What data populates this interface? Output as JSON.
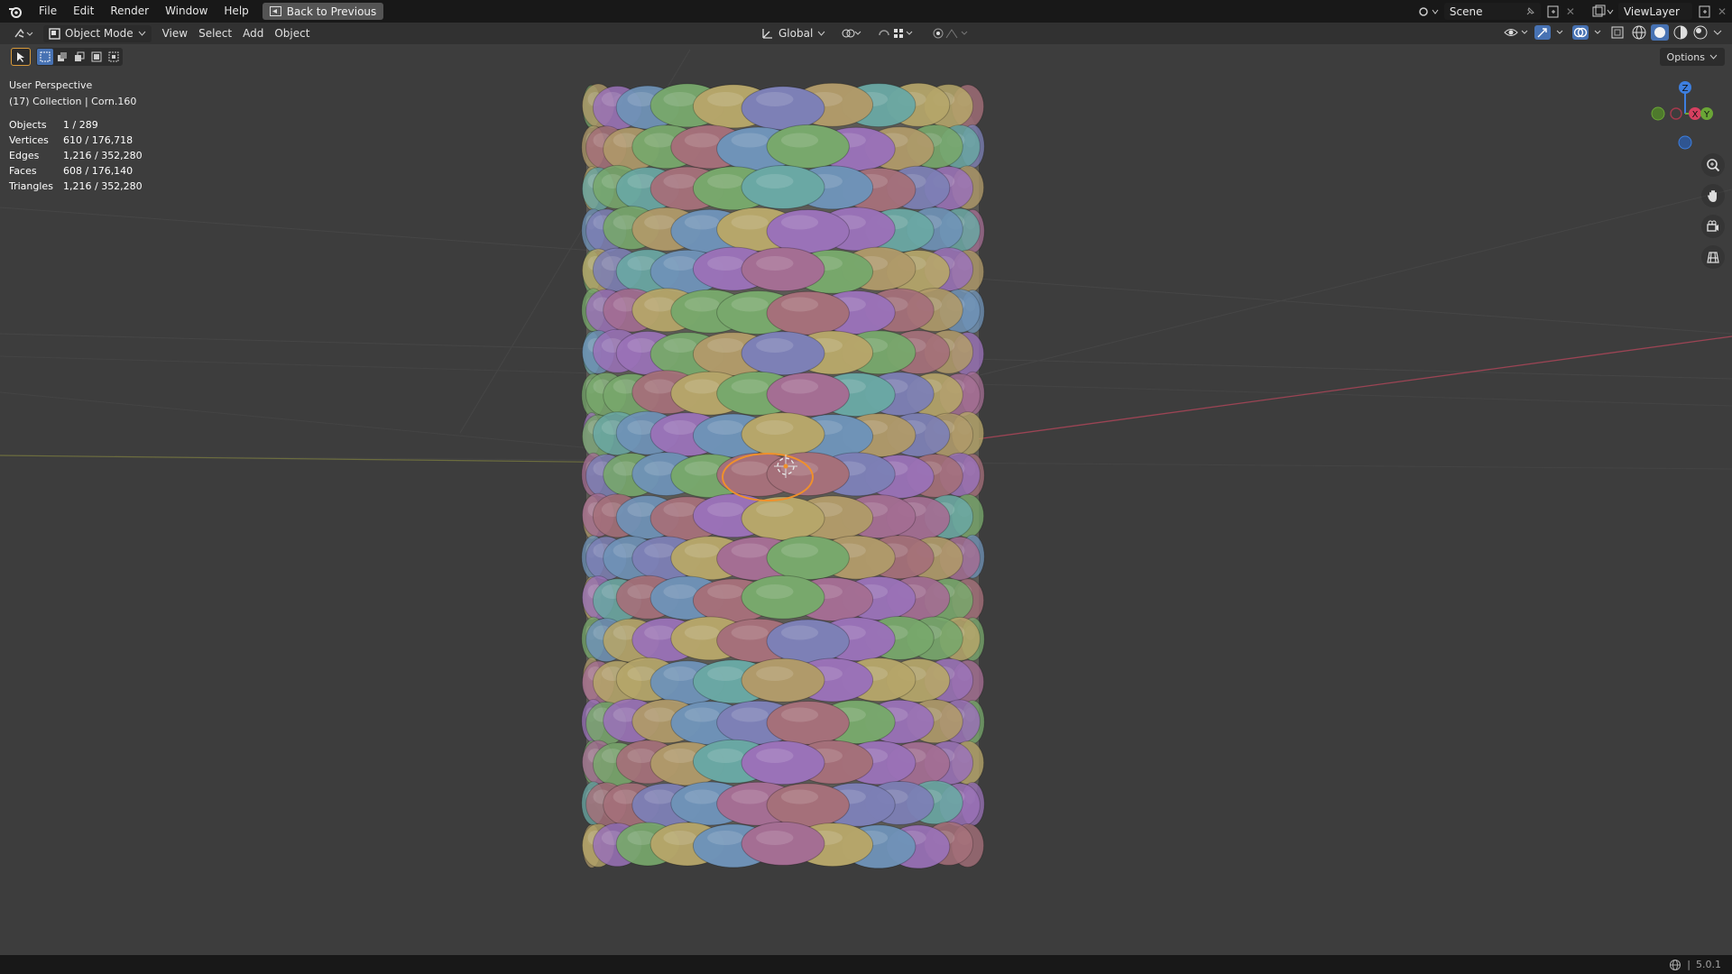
{
  "topbar": {
    "menus": [
      "File",
      "Edit",
      "Render",
      "Window",
      "Help"
    ],
    "back_button": "Back to Previous",
    "scene_field": "Scene",
    "viewlayer_field": "ViewLayer"
  },
  "header": {
    "mode": "Object Mode",
    "menus": [
      "View",
      "Select",
      "Add",
      "Object"
    ],
    "transform_orientation": "Global",
    "options_label": "Options"
  },
  "overlay": {
    "view_name": "User Perspective",
    "collection_info": "(17) Collection | Corn.160"
  },
  "stats": [
    {
      "label": "Objects",
      "value": "1 / 289"
    },
    {
      "label": "Vertices",
      "value": "610 / 176,718"
    },
    {
      "label": "Edges",
      "value": "1,216 / 352,280"
    },
    {
      "label": "Faces",
      "value": "608 / 176,140"
    },
    {
      "label": "Triangles",
      "value": "1,216 / 352,280"
    }
  ],
  "gizmo": {
    "x": "X",
    "y": "Y",
    "z": "Z"
  },
  "statusbar": {
    "version": "5.0.1"
  },
  "colors": {
    "background": "#3d3d3d",
    "selection_outline": "#f0902b",
    "x_axis": "#c8364a",
    "accent": "#4772b3",
    "kernel_palette": [
      "#9a72b8",
      "#b09a6a",
      "#6f93b8",
      "#a5707a",
      "#78a86c",
      "#b6a66a",
      "#6aa8a4",
      "#a46e93",
      "#7d80b6"
    ]
  },
  "icons": [
    "blender-logo-icon",
    "back-icon",
    "scene-icon",
    "pin-icon",
    "copy-icon",
    "viewlayer-icon",
    "editor-type-icon",
    "object-mode-icon",
    "transform-icon",
    "pivot-icon",
    "snap-icon",
    "proportional-icon",
    "visibility-icon",
    "gizmo-icon",
    "overlay-icon",
    "xray-icon",
    "wireframe-shading-icon",
    "solid-shading-icon",
    "material-shading-icon",
    "rendered-shading-icon",
    "zoom-icon",
    "pan-icon",
    "camera-icon",
    "grid-icon",
    "select-tool-icon",
    "globe-icon"
  ]
}
